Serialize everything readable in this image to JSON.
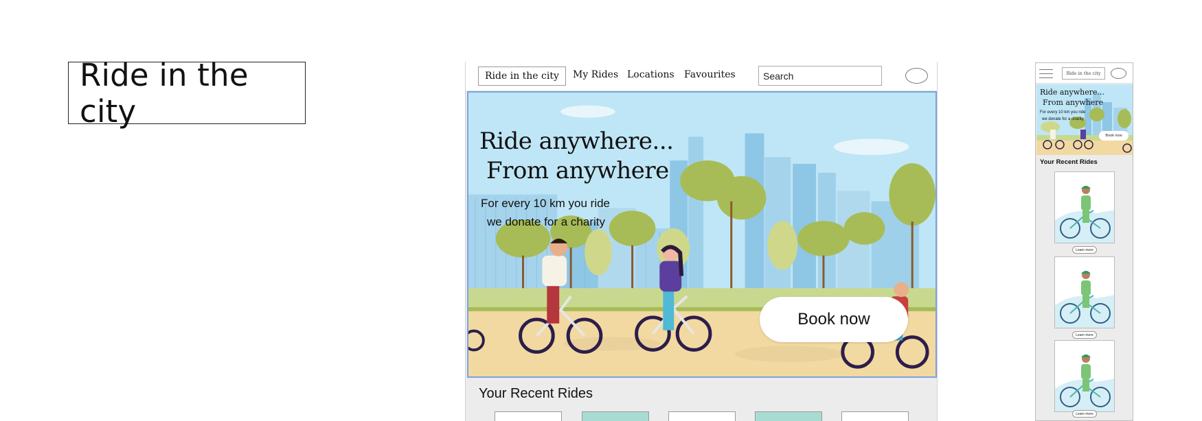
{
  "title_box": {
    "text": "Ride in the city"
  },
  "desktop": {
    "nav": {
      "brand": "Ride in the city",
      "links": [
        "My Rides",
        "Locations",
        "Favourites"
      ],
      "search_placeholder": "Search"
    },
    "hero": {
      "headline_line1": "Ride anywhere...",
      "headline_line2": "From anywhere",
      "subtext_line1": "For every 10 km you ride",
      "subtext_line2": "we donate for a charity",
      "cta": "Book now"
    },
    "recent_heading": "Your Recent Rides"
  },
  "mobile": {
    "nav": {
      "brand": "Ride in the city"
    },
    "hero": {
      "headline_line1": "Ride anywhere...",
      "headline_line2": "From anywhere",
      "subtext_line1": "For every 10 km you ride",
      "subtext_line2": "we donate for a charity",
      "cta": "Book now"
    },
    "recent_heading": "Your Recent Rides",
    "cards": [
      {
        "button": "Learn more"
      },
      {
        "button": "Learn more"
      },
      {
        "button": "Learn more"
      }
    ]
  },
  "colors": {
    "sky": "#bfe6f6",
    "building": "#8ec6e6",
    "tree": "#a7bc56",
    "ground": "#f2d9a2",
    "hero_border": "#7aa3e0",
    "card_teal": "#a8dcd3"
  }
}
